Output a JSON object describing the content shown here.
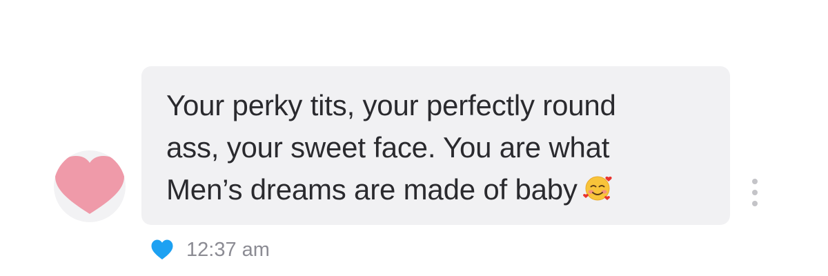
{
  "message": {
    "lines": [
      "Your perky tits, your perfectly round",
      "ass, your sweet face. You are what",
      "Men’s dreams are made of baby"
    ],
    "emoji_icon": "smiling-face-with-hearts-icon",
    "timestamp": "12:37 am",
    "like_icon": "heart-icon",
    "like_color": "#1da1f2",
    "bubble_color": "#f1f1f3"
  },
  "avatar": {
    "icon": "heart-avatar-icon",
    "color": "#ef9aa9"
  },
  "options_icon": "more-options-icon"
}
